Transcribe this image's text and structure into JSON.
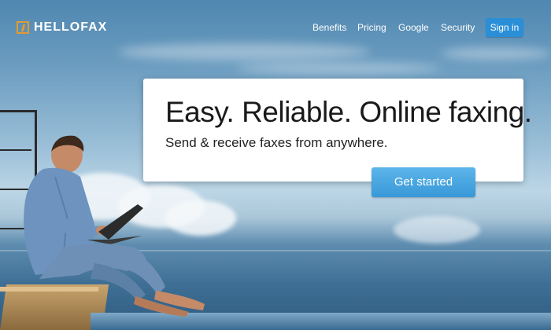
{
  "brand": {
    "name": "HELLOFAX",
    "accent_color": "#e59a2e"
  },
  "nav": {
    "items": [
      {
        "label": "Benefits"
      },
      {
        "label": "Pricing"
      },
      {
        "label": "Google"
      },
      {
        "label": "Security"
      }
    ],
    "signin_label": "Sign in"
  },
  "hero": {
    "headline": "Easy. Reliable. Online faxing.",
    "subheadline": "Send & receive faxes from anywhere.",
    "cta_label": "Get started",
    "cta_color": "#3898d8"
  },
  "background": {
    "scene": "man-with-laptop-by-ocean-photo"
  }
}
